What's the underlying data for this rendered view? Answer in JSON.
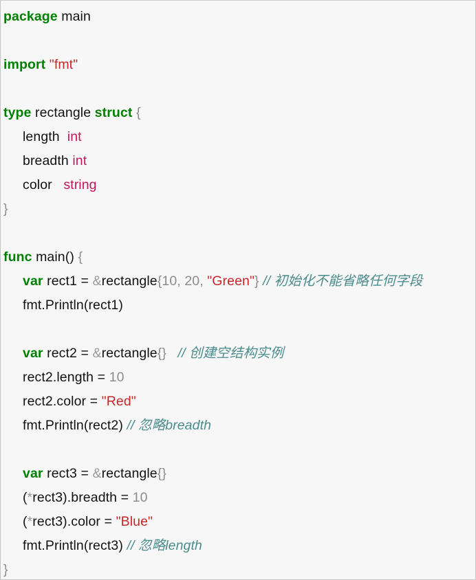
{
  "editor": {
    "language": "Go",
    "background_color": "#f7f7f7",
    "border_color": "#c9c9c9",
    "colors": {
      "keyword": "#008000",
      "type": "#c2185b",
      "string": "#c62828",
      "number": "#8c8c8c",
      "punctuation": "#8c8c8c",
      "ampersand": "#9a9a9a",
      "comment": "#4a8c8c",
      "plain": "#111111"
    }
  },
  "code": {
    "lines": [
      {
        "id": "line-package",
        "indent": 0,
        "tokens": [
          {
            "kind": "keyword",
            "text": "package"
          },
          {
            "kind": "plain",
            "text": " main"
          }
        ]
      },
      {
        "id": "line-blank-1",
        "indent": 0,
        "tokens": []
      },
      {
        "id": "line-import",
        "indent": 0,
        "tokens": [
          {
            "kind": "keyword",
            "text": "import"
          },
          {
            "kind": "plain",
            "text": " "
          },
          {
            "kind": "string",
            "text": "\"fmt\""
          }
        ]
      },
      {
        "id": "line-blank-2",
        "indent": 0,
        "tokens": []
      },
      {
        "id": "line-type-rectangle",
        "indent": 0,
        "tokens": [
          {
            "kind": "keyword",
            "text": "type"
          },
          {
            "kind": "plain",
            "text": " rectangle "
          },
          {
            "kind": "keyword",
            "text": "struct"
          },
          {
            "kind": "plain",
            "text": " "
          },
          {
            "kind": "punct",
            "text": "{"
          }
        ]
      },
      {
        "id": "line-field-length",
        "indent": 1,
        "tokens": [
          {
            "kind": "plain",
            "text": "length  "
          },
          {
            "kind": "type",
            "text": "int"
          }
        ]
      },
      {
        "id": "line-field-breadth",
        "indent": 1,
        "tokens": [
          {
            "kind": "plain",
            "text": "breadth "
          },
          {
            "kind": "type",
            "text": "int"
          }
        ]
      },
      {
        "id": "line-field-color",
        "indent": 1,
        "tokens": [
          {
            "kind": "plain",
            "text": "color   "
          },
          {
            "kind": "type",
            "text": "string"
          }
        ]
      },
      {
        "id": "line-struct-close",
        "indent": 0,
        "tokens": [
          {
            "kind": "punct",
            "text": "}"
          }
        ]
      },
      {
        "id": "line-blank-3",
        "indent": 0,
        "tokens": []
      },
      {
        "id": "line-func-main",
        "indent": 0,
        "tokens": [
          {
            "kind": "keyword",
            "text": "func"
          },
          {
            "kind": "plain",
            "text": " main() "
          },
          {
            "kind": "punct",
            "text": "{"
          }
        ]
      },
      {
        "id": "line-var-rect1",
        "indent": 1,
        "tokens": [
          {
            "kind": "keyword",
            "text": "var"
          },
          {
            "kind": "plain",
            "text": " rect1 "
          },
          {
            "kind": "op",
            "text": "="
          },
          {
            "kind": "plain",
            "text": " "
          },
          {
            "kind": "amp",
            "text": "&"
          },
          {
            "kind": "plain",
            "text": "rectangle"
          },
          {
            "kind": "punct",
            "text": "{"
          },
          {
            "kind": "number",
            "text": "10"
          },
          {
            "kind": "punct",
            "text": ", "
          },
          {
            "kind": "number",
            "text": "20"
          },
          {
            "kind": "punct",
            "text": ", "
          },
          {
            "kind": "string",
            "text": "\"Green\""
          },
          {
            "kind": "punct",
            "text": "}"
          },
          {
            "kind": "plain",
            "text": " "
          },
          {
            "kind": "comment",
            "text": "// 初始化不能省略任何字段"
          }
        ]
      },
      {
        "id": "line-print-rect1",
        "indent": 1,
        "tokens": [
          {
            "kind": "plain",
            "text": "fmt.Println(rect1)"
          }
        ]
      },
      {
        "id": "line-blank-4",
        "indent": 0,
        "tokens": []
      },
      {
        "id": "line-var-rect2",
        "indent": 1,
        "tokens": [
          {
            "kind": "keyword",
            "text": "var"
          },
          {
            "kind": "plain",
            "text": " rect2 "
          },
          {
            "kind": "op",
            "text": "="
          },
          {
            "kind": "plain",
            "text": " "
          },
          {
            "kind": "amp",
            "text": "&"
          },
          {
            "kind": "plain",
            "text": "rectangle"
          },
          {
            "kind": "punct",
            "text": "{}"
          },
          {
            "kind": "plain",
            "text": "   "
          },
          {
            "kind": "comment",
            "text": "// 创建空结构实例"
          }
        ]
      },
      {
        "id": "line-rect2-length",
        "indent": 1,
        "tokens": [
          {
            "kind": "plain",
            "text": "rect2.length "
          },
          {
            "kind": "op",
            "text": "="
          },
          {
            "kind": "plain",
            "text": " "
          },
          {
            "kind": "number",
            "text": "10"
          }
        ]
      },
      {
        "id": "line-rect2-color",
        "indent": 1,
        "tokens": [
          {
            "kind": "plain",
            "text": "rect2.color "
          },
          {
            "kind": "op",
            "text": "="
          },
          {
            "kind": "plain",
            "text": " "
          },
          {
            "kind": "string",
            "text": "\"Red\""
          }
        ]
      },
      {
        "id": "line-print-rect2",
        "indent": 1,
        "tokens": [
          {
            "kind": "plain",
            "text": "fmt.Println(rect2) "
          },
          {
            "kind": "comment",
            "text": "// 忽略breadth"
          }
        ]
      },
      {
        "id": "line-blank-5",
        "indent": 0,
        "tokens": []
      },
      {
        "id": "line-var-rect3",
        "indent": 1,
        "tokens": [
          {
            "kind": "keyword",
            "text": "var"
          },
          {
            "kind": "plain",
            "text": " rect3 "
          },
          {
            "kind": "op",
            "text": "="
          },
          {
            "kind": "plain",
            "text": " "
          },
          {
            "kind": "amp",
            "text": "&"
          },
          {
            "kind": "plain",
            "text": "rectangle"
          },
          {
            "kind": "punct",
            "text": "{}"
          }
        ]
      },
      {
        "id": "line-rect3-breadth",
        "indent": 1,
        "tokens": [
          {
            "kind": "plain",
            "text": "("
          },
          {
            "kind": "amp",
            "text": "*"
          },
          {
            "kind": "plain",
            "text": "rect3).breadth "
          },
          {
            "kind": "op",
            "text": "="
          },
          {
            "kind": "plain",
            "text": " "
          },
          {
            "kind": "number",
            "text": "10"
          }
        ]
      },
      {
        "id": "line-rect3-color",
        "indent": 1,
        "tokens": [
          {
            "kind": "plain",
            "text": "("
          },
          {
            "kind": "amp",
            "text": "*"
          },
          {
            "kind": "plain",
            "text": "rect3).color "
          },
          {
            "kind": "op",
            "text": "="
          },
          {
            "kind": "plain",
            "text": " "
          },
          {
            "kind": "string",
            "text": "\"Blue\""
          }
        ]
      },
      {
        "id": "line-print-rect3",
        "indent": 1,
        "tokens": [
          {
            "kind": "plain",
            "text": "fmt.Println(rect3) "
          },
          {
            "kind": "comment",
            "text": "// 忽略length"
          }
        ]
      },
      {
        "id": "line-func-close",
        "indent": 0,
        "tokens": [
          {
            "kind": "punct",
            "text": "}"
          }
        ]
      }
    ]
  }
}
